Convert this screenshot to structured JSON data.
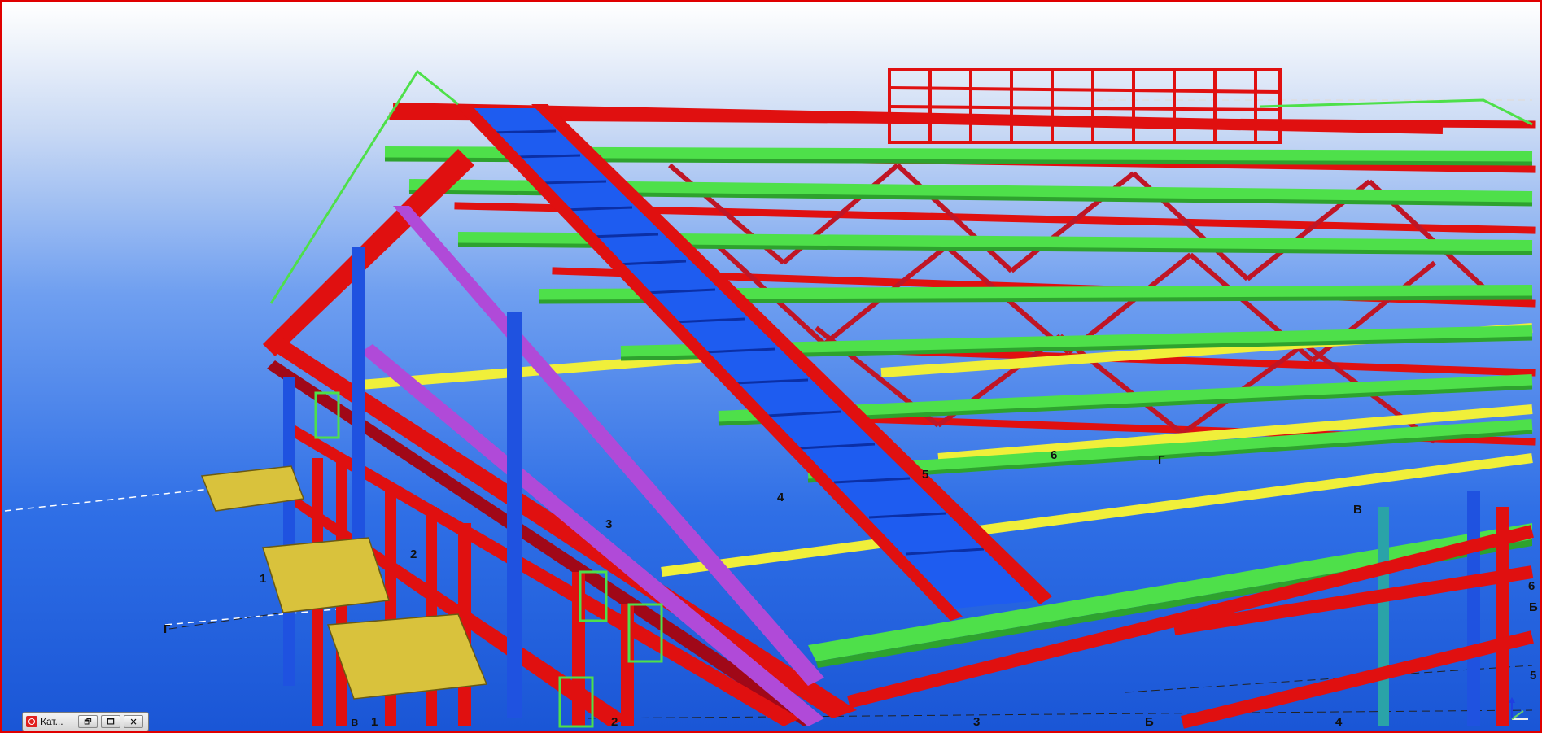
{
  "window": {
    "minimized_title": "Кат...",
    "buttons": {
      "restore": "🗗",
      "maximize": "🗖",
      "close": "🗙"
    }
  },
  "grid_labels": {
    "g_left": "Г",
    "one_left": "1",
    "two_left": "2",
    "three_left": "3",
    "four_mid": "4",
    "five_mid": "5",
    "six_mid": "6",
    "g_mid": "Г",
    "v_mid": "В",
    "v_bottom": "в",
    "one_bottom": "1",
    "two_bottom": "2",
    "three_bottom": "3",
    "b_bottom": "Б",
    "four_bottom": "4",
    "six_right": "6",
    "b_right": "Б",
    "five_right": "5"
  },
  "colors": {
    "border": "#e00000",
    "steel_red": "#e01010",
    "purlin_green": "#4ee04a",
    "column_blue": "#1f52e0",
    "bracing_purple": "#b04ad8",
    "beam_yellow": "#f0ef3a",
    "platform_gold": "#d9c23c"
  },
  "icons": {
    "app": "tekla-app-icon",
    "axis": "coordinate-axis-icon"
  }
}
